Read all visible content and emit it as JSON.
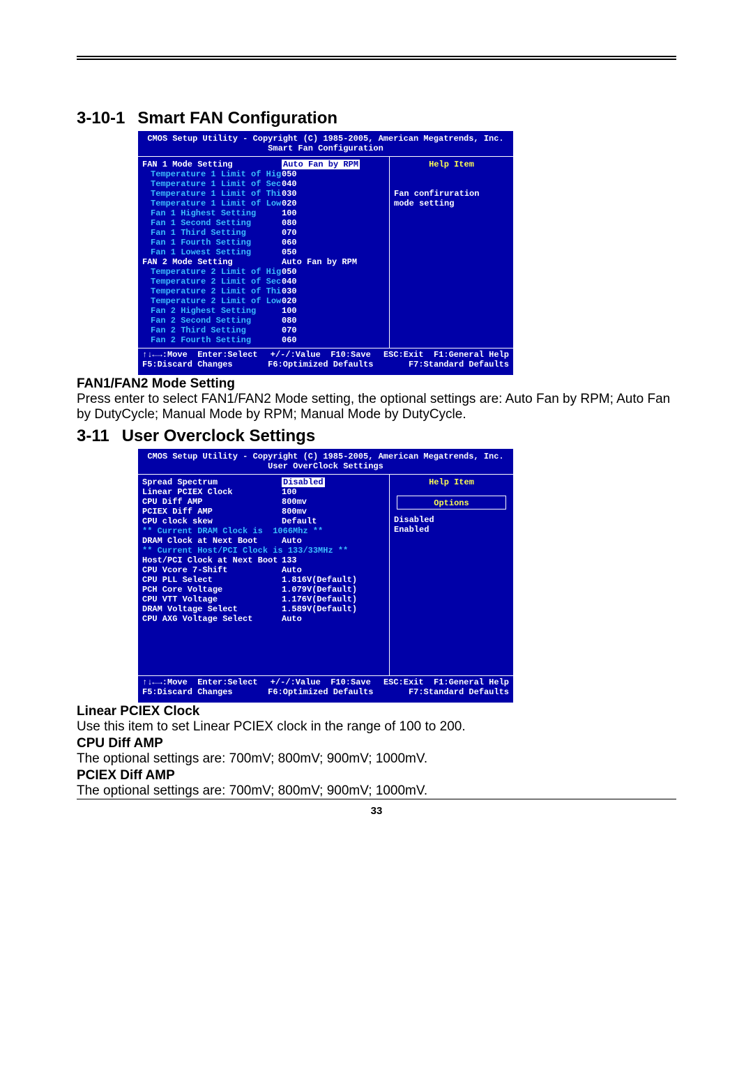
{
  "page_number": "33",
  "section1": {
    "number": "3-10-1",
    "title": "Smart FAN Configuration",
    "bios": {
      "copyright": "CMOS Setup Utility - Copyright (C) 1985-2005, American Megatrends, Inc.",
      "subtitle": "Smart Fan Configuration",
      "rows": [
        {
          "label": "FAN 1 Mode Setting",
          "value": "Auto Fan by RPM",
          "label_style": "w",
          "selected": true,
          "indent": false
        },
        {
          "label": "Temperature 1 Limit of Hig",
          "value": "050",
          "label_style": "b",
          "indent": true
        },
        {
          "label": "Temperature 1 Limit of Sec",
          "value": "040",
          "label_style": "b",
          "indent": true
        },
        {
          "label": "Temperature 1 Limit of Thi",
          "value": "030",
          "label_style": "b",
          "indent": true
        },
        {
          "label": "Temperature 1 Limit of Low",
          "value": "020",
          "label_style": "b",
          "indent": true
        },
        {
          "label": "Fan 1 Highest Setting",
          "value": "100",
          "label_style": "b",
          "indent": true
        },
        {
          "label": "Fan 1 Second Setting",
          "value": "080",
          "label_style": "b",
          "indent": true
        },
        {
          "label": "Fan 1 Third Setting",
          "value": "070",
          "label_style": "b",
          "indent": true
        },
        {
          "label": "Fan 1 Fourth Setting",
          "value": "060",
          "label_style": "b",
          "indent": true
        },
        {
          "label": "Fan 1 Lowest Setting",
          "value": "050",
          "label_style": "b",
          "indent": true
        },
        {
          "label": "FAN 2 Mode Setting",
          "value": "Auto Fan by RPM",
          "label_style": "w",
          "indent": false
        },
        {
          "label": "Temperature 2 Limit of Hig",
          "value": "050",
          "label_style": "b",
          "indent": true
        },
        {
          "label": "Temperature 2 Limit of Sec",
          "value": "040",
          "label_style": "b",
          "indent": true
        },
        {
          "label": "Temperature 2 Limit of Thi",
          "value": "030",
          "label_style": "b",
          "indent": true
        },
        {
          "label": "Temperature 2 Limit of Low",
          "value": "020",
          "label_style": "b",
          "indent": true
        },
        {
          "label": "Fan 2 Highest Setting",
          "value": "100",
          "label_style": "b",
          "indent": true
        },
        {
          "label": "Fan 2 Second Setting",
          "value": "080",
          "label_style": "b",
          "indent": true
        },
        {
          "label": "Fan 2 Third Setting",
          "value": "070",
          "label_style": "b",
          "indent": true
        },
        {
          "label": "Fan 2 Fourth Setting",
          "value": "060",
          "label_style": "b",
          "indent": true
        }
      ],
      "help": {
        "title": "Help Item",
        "lines": [
          "Fan confiruration",
          "mode setting"
        ]
      },
      "footer": {
        "l1a": "↑↓←→:Move  Enter:Select",
        "l1b": "+/-/:Value  F10:Save",
        "l1c": "ESC:Exit  F1:General Help",
        "l2a": "F5:Discard Changes",
        "l2b": "F6:Optimized Defaults",
        "l2c": "F7:Standard Defaults"
      }
    },
    "sub_heading": "FAN1/FAN2 Mode Setting",
    "body": "Press enter to select FAN1/FAN2 Mode setting, the optional settings are: Auto Fan by RPM; Auto Fan by DutyCycle; Manual Mode by RPM; Manual Mode by DutyCycle."
  },
  "section2": {
    "number": "3-11",
    "title": "User Overclock Settings",
    "bios": {
      "copyright": "CMOS Setup Utility - Copyright (C) 1985-2005, American Megatrends, Inc.",
      "subtitle": "User OverClock Settings",
      "rows": [
        {
          "label": "Spread Spectrum",
          "value": "Disabled",
          "label_style": "w",
          "selected": true
        },
        {
          "label": "Linear PCIEX Clock",
          "value": "100",
          "label_style": "w"
        },
        {
          "label": "CPU Diff AMP",
          "value": "800mv",
          "label_style": "w"
        },
        {
          "label": "PCIEX Diff AMP",
          "value": "800mv",
          "label_style": "w"
        },
        {
          "label": "CPU clock skew",
          "value": "Default",
          "label_style": "w"
        },
        {
          "label": "** Current DRAM Clock is  1066Mhz **",
          "value": "",
          "label_style": "b",
          "full": true
        },
        {
          "label": "DRAM Clock at Next Boot",
          "value": "Auto",
          "label_style": "w"
        },
        {
          "label": "** Current Host/PCI Clock is 133/33MHz **",
          "value": "",
          "label_style": "b",
          "full": true
        },
        {
          "label": "Host/PCI Clock at Next Boot",
          "value": "133",
          "label_style": "w"
        },
        {
          "label": "CPU Vcore 7-Shift",
          "value": "Auto",
          "label_style": "w"
        },
        {
          "label": "CPU PLL Select",
          "value": "1.816V(Default)",
          "label_style": "w"
        },
        {
          "label": "PCH Core Voltage",
          "value": "1.079V(Default)",
          "label_style": "w"
        },
        {
          "label": "CPU VTT Voltage",
          "value": "1.176V(Default)",
          "label_style": "w"
        },
        {
          "label": "DRAM Voltage Select",
          "value": "1.589V(Default)",
          "label_style": "w"
        },
        {
          "label": "CPU AXG Voltage Select",
          "value": "Auto",
          "label_style": "w"
        }
      ],
      "help": {
        "title": "Help Item",
        "options_label": "Options",
        "lines": [
          "Disabled",
          "Enabled"
        ]
      },
      "footer": {
        "l1a": "↑↓←→:Move  Enter:Select",
        "l1b": "+/-/:Value  F10:Save",
        "l1c": "ESC:Exit  F1:General Help",
        "l2a": "F5:Discard Changes",
        "l2b": "F6:Optimized Defaults",
        "l2c": "F7:Standard Defaults"
      }
    },
    "subs": [
      {
        "head": "Linear PCIEX Clock",
        "body": "Use this item to set Linear PCIEX clock in the range of 100 to 200."
      },
      {
        "head": "CPU Diff AMP",
        "body": "The optional settings are: 700mV; 800mV; 900mV; 1000mV."
      },
      {
        "head": "PCIEX Diff AMP",
        "body": "The optional settings are: 700mV; 800mV; 900mV; 1000mV."
      }
    ]
  }
}
